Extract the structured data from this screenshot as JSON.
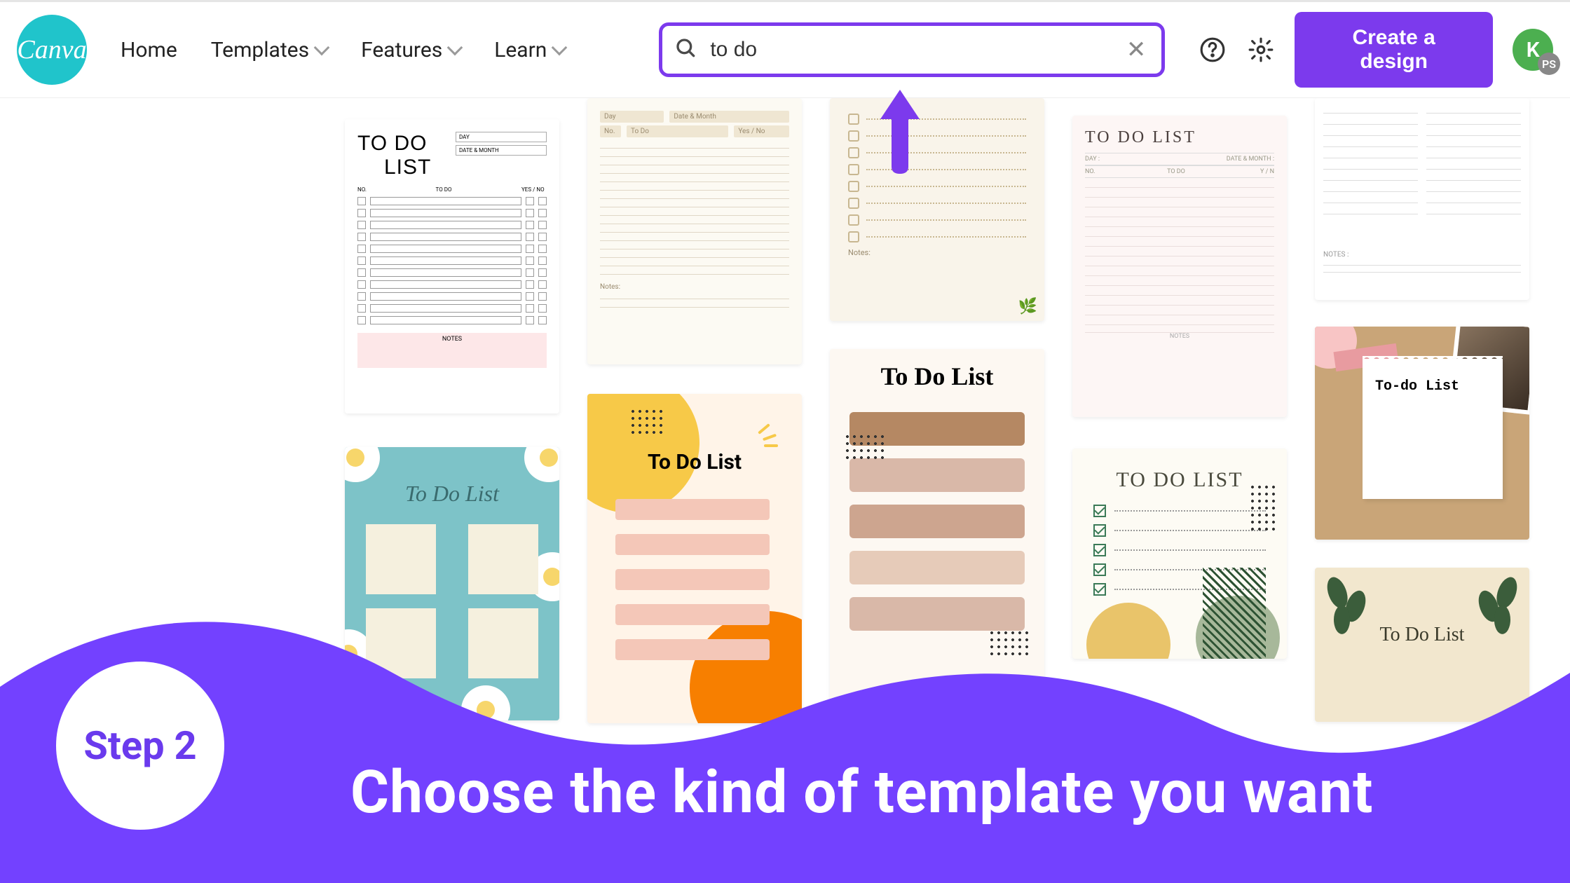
{
  "header": {
    "logo_text": "Canva",
    "nav": {
      "home": "Home",
      "templates": "Templates",
      "features": "Features",
      "learn": "Learn"
    },
    "search": {
      "value": "to do",
      "placeholder": "Search"
    },
    "create_button": "Create a design",
    "avatar_initial": "K",
    "avatar_badge": "PS"
  },
  "templates": {
    "c1a": {
      "title1": "TO DO",
      "title2": "LIST",
      "day_label": "DAY",
      "date_label": "DATE & MONTH",
      "col_no": "NO.",
      "col_todo": "TO DO",
      "col_yn": "YES / NO",
      "notes": "NOTES"
    },
    "c1b": {
      "title": "To Do List"
    },
    "c2a": {
      "day": "Day",
      "date": "Date & Month",
      "no": "No.",
      "todo": "To Do",
      "yn": "Yes / No",
      "notes": "Notes:"
    },
    "c2b": {
      "title": "To Do List"
    },
    "c3a": {
      "notes": "Notes:"
    },
    "c3b": {
      "title": "To Do List"
    },
    "c4a": {
      "title": "TO DO LIST",
      "day": "DAY :",
      "date": "DATE & MONTH :",
      "no": "NO.",
      "todo": "TO DO",
      "yn": "Y / N",
      "notes": "NOTES"
    },
    "c4b": {
      "title": "TO DO LIST"
    },
    "c5a": {
      "notes": "NOTES :"
    },
    "c5b": {
      "title": "To-do List"
    },
    "c5c": {
      "title": "To Do List"
    }
  },
  "overlay": {
    "step_label": "Step 2",
    "headline": "Choose the kind of template you want"
  },
  "colors": {
    "accent": "#7c3aed",
    "logo": "#20c4cb"
  }
}
